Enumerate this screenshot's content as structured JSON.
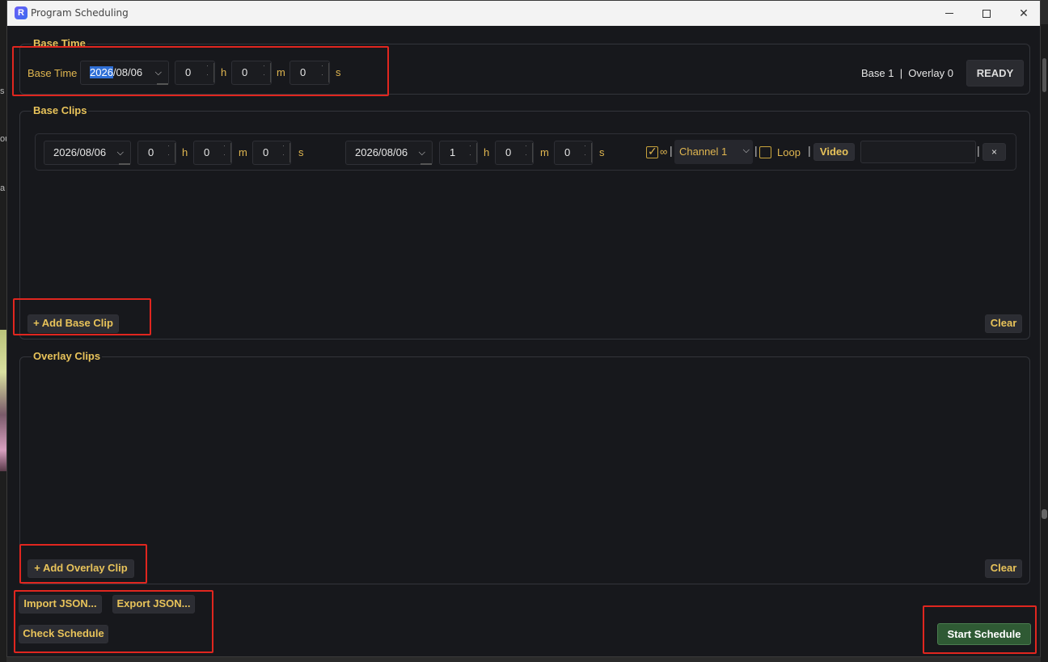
{
  "window": {
    "title": "Program Scheduling",
    "icon_letter": "R",
    "minimize_label": "—",
    "close_label": "✕"
  },
  "base_time": {
    "group_title": "Base Time",
    "label": "Base Time",
    "date": "2026/08/06",
    "date_selected_part": "2026",
    "date_rest": "/08/06",
    "hours": "0",
    "minutes": "0",
    "seconds": "0",
    "unit_h": "h",
    "unit_m": "m",
    "unit_s": "s",
    "status_text": "Base 1  |  Overlay 0",
    "ready_button": "READY"
  },
  "base_clips": {
    "group_title": "Base Clips",
    "rows": [
      {
        "start_date": "2026/08/06",
        "start_h": "0",
        "start_m": "0",
        "start_s": "0",
        "end_date": "2026/08/06",
        "end_h": "1",
        "end_m": "0",
        "end_s": "0",
        "infinite_checked": true,
        "infinite_symbol": "∞",
        "channel": "Channel 1",
        "loop_checked": false,
        "loop_label": "Loop",
        "video_button": "Video",
        "video_path": "",
        "remove_button": "×"
      }
    ],
    "add_button": "+ Add Base Clip",
    "clear_button": "Clear"
  },
  "overlay_clips": {
    "group_title": "Overlay Clips",
    "add_button": "+ Add Overlay Clip",
    "clear_button": "Clear"
  },
  "footer": {
    "import_button": "Import JSON...",
    "export_button": "Export JSON...",
    "check_button": "Check Schedule",
    "start_button": "Start Schedule"
  },
  "background": {
    "left_fragments": [
      "s",
      "ou",
      "a"
    ]
  },
  "colors": {
    "accent_gold": "#e0b650",
    "window_bg": "#17181c",
    "highlight_red": "#e0261f",
    "start_green": "#2f5a34",
    "selection_blue": "#2f6fd6"
  }
}
